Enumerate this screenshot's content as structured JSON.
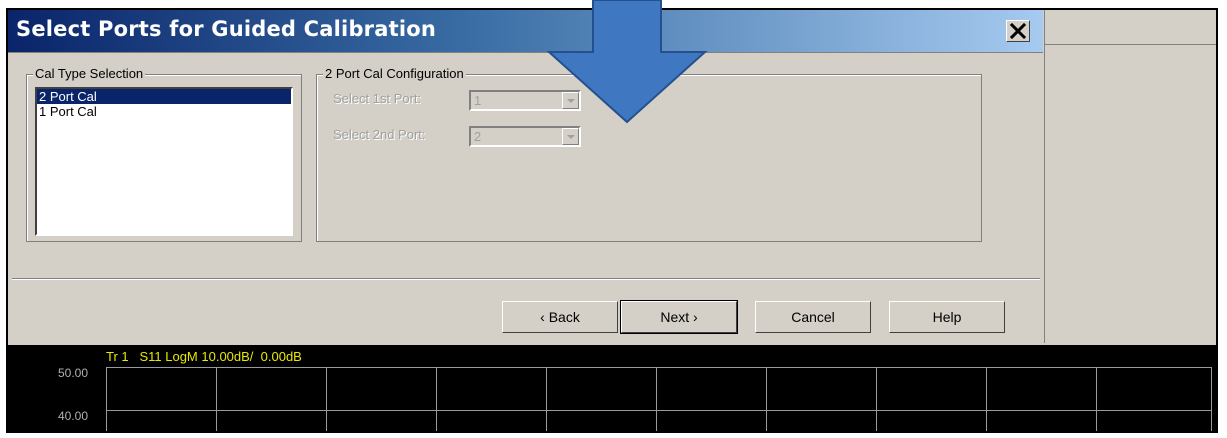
{
  "dialog": {
    "title": "Select Ports for Guided Calibration",
    "close_symbol": "✕"
  },
  "cal_type": {
    "legend": "Cal Type Selection",
    "items": [
      "2 Port Cal",
      "1 Port Cal"
    ],
    "selected_index": 0
  },
  "config": {
    "legend": "2 Port Cal Configuration",
    "first_port_label": "Select 1st Port:",
    "first_port_value": "1",
    "second_port_label": "Select 2nd Port:",
    "second_port_value": "2"
  },
  "buttons": {
    "back": "‹ Back",
    "next": "Next ›",
    "cancel": "Cancel",
    "help": "Help"
  },
  "trace": {
    "label": "Tr 1   S11 LogM 10.00dB/  0.00dB",
    "y_ticks": [
      "50.00",
      "40.00"
    ],
    "color": "#e8e800"
  },
  "colors": {
    "title_bar_start": "#0a246a",
    "overlay_arrow": "#3f78c0"
  }
}
